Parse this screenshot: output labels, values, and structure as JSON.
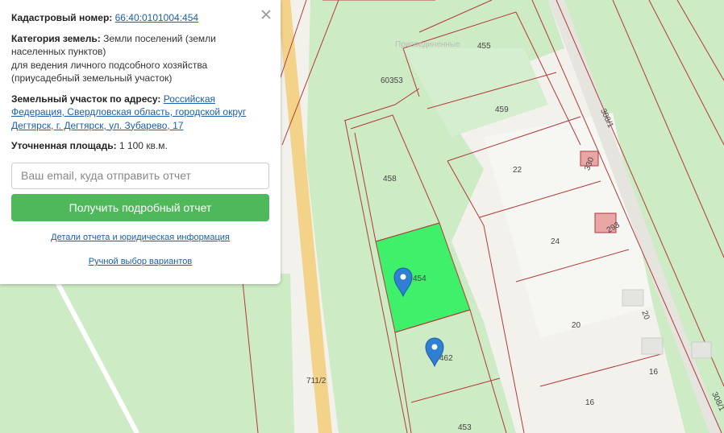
{
  "info_panel": {
    "cadastral_label": "Кадастровый номер:",
    "cadastral_number": "66:40:0101004:454",
    "category_label": "Категория земель:",
    "category_value": "Земли поселений (земли населенных пунктов)",
    "category_line2": "для ведения личного подсобного хозяйства",
    "category_line3": "(приусадебный земельный участок)",
    "address_label": "Земельный участок по адресу:",
    "address_value": "Российская Федерация, Свердловская область, городской округ Дегтярск, г. Дегтярск, ул. Зубарево, 17",
    "area_label": "Уточненная площадь:",
    "area_value": "1 100 кв.м.",
    "email_placeholder": "Ваш email, куда отправить отчет",
    "report_button": "Получить подробный отчет",
    "details_link": "Детали отчета и юридическая информация",
    "manual_link": "Ручной выбор вариантов"
  },
  "map": {
    "selected_plot_color": "#3ef06a",
    "boundary_color": "#b23a3a",
    "faded_label": "Присоединенные",
    "plot_labels": [
      "455",
      "60353",
      "459",
      "458",
      "22",
      "330",
      "24",
      "293",
      "454",
      "20",
      "462",
      "16",
      "16",
      "453",
      "711/2",
      "308/1",
      "308/1",
      "20"
    ],
    "markers": [
      "marker-454",
      "marker-462"
    ]
  }
}
